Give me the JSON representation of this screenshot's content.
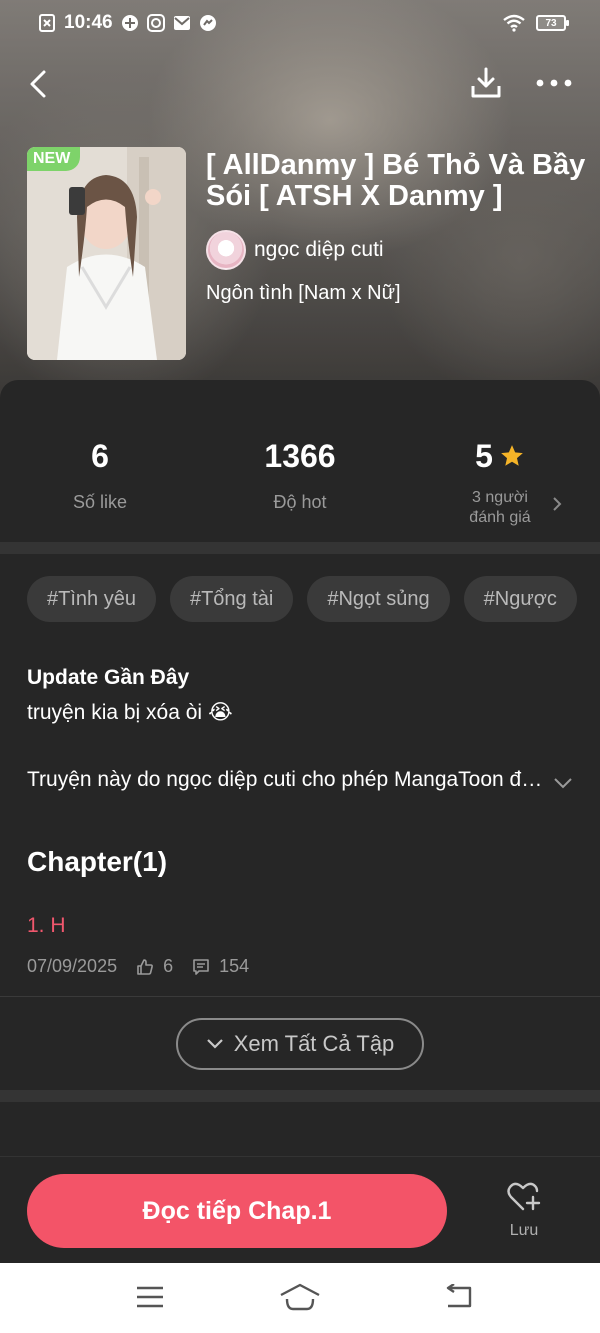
{
  "status_bar": {
    "time": "10:46",
    "battery": "73"
  },
  "comic": {
    "badge": "NEW",
    "title": "[ AllDanmy ] Bé Thỏ Và Bầy Sói [ ATSH X Danmy ]",
    "author": "ngọc diệp cuti",
    "genre": "Ngôn tình [Nam x Nữ]"
  },
  "stats": {
    "likes_value": "6",
    "likes_label": "Số like",
    "hot_value": "1366",
    "hot_label": "Độ hot",
    "rating_value": "5",
    "rating_count_line1": "3 người",
    "rating_count_line2": "đánh giá"
  },
  "tags": [
    "#Tình yêu",
    "#Tổng tài",
    "#Ngọt sủng",
    "#Ngược"
  ],
  "update": {
    "heading": "Update Gần Đây",
    "text": "truyện kia bị xóa òi",
    "emoji": "😭"
  },
  "description": "Truyện này do ngọc diệp cuti cho phép MangaToon đăng tải",
  "chapters": {
    "heading": "Chapter(1)",
    "items": [
      {
        "title": "1. H",
        "date": "07/09/2025",
        "likes": "6",
        "comments": "154"
      }
    ],
    "see_all_label": "Xem Tất Cả Tập"
  },
  "actions": {
    "read_label": "Đọc tiếp Chap.1",
    "save_label": "Lưu"
  },
  "colors": {
    "accent": "#f35468",
    "chapter_title": "#f0576d",
    "badge": "#7ed36a",
    "star": "#f5b428",
    "background": "#262626"
  },
  "icons": {
    "back": "chevron-left-icon",
    "download": "download-icon",
    "more": "more-dots-icon",
    "star": "star-icon",
    "like": "thumbs-up-icon",
    "comment": "comment-icon",
    "heart_add": "heart-plus-icon"
  }
}
